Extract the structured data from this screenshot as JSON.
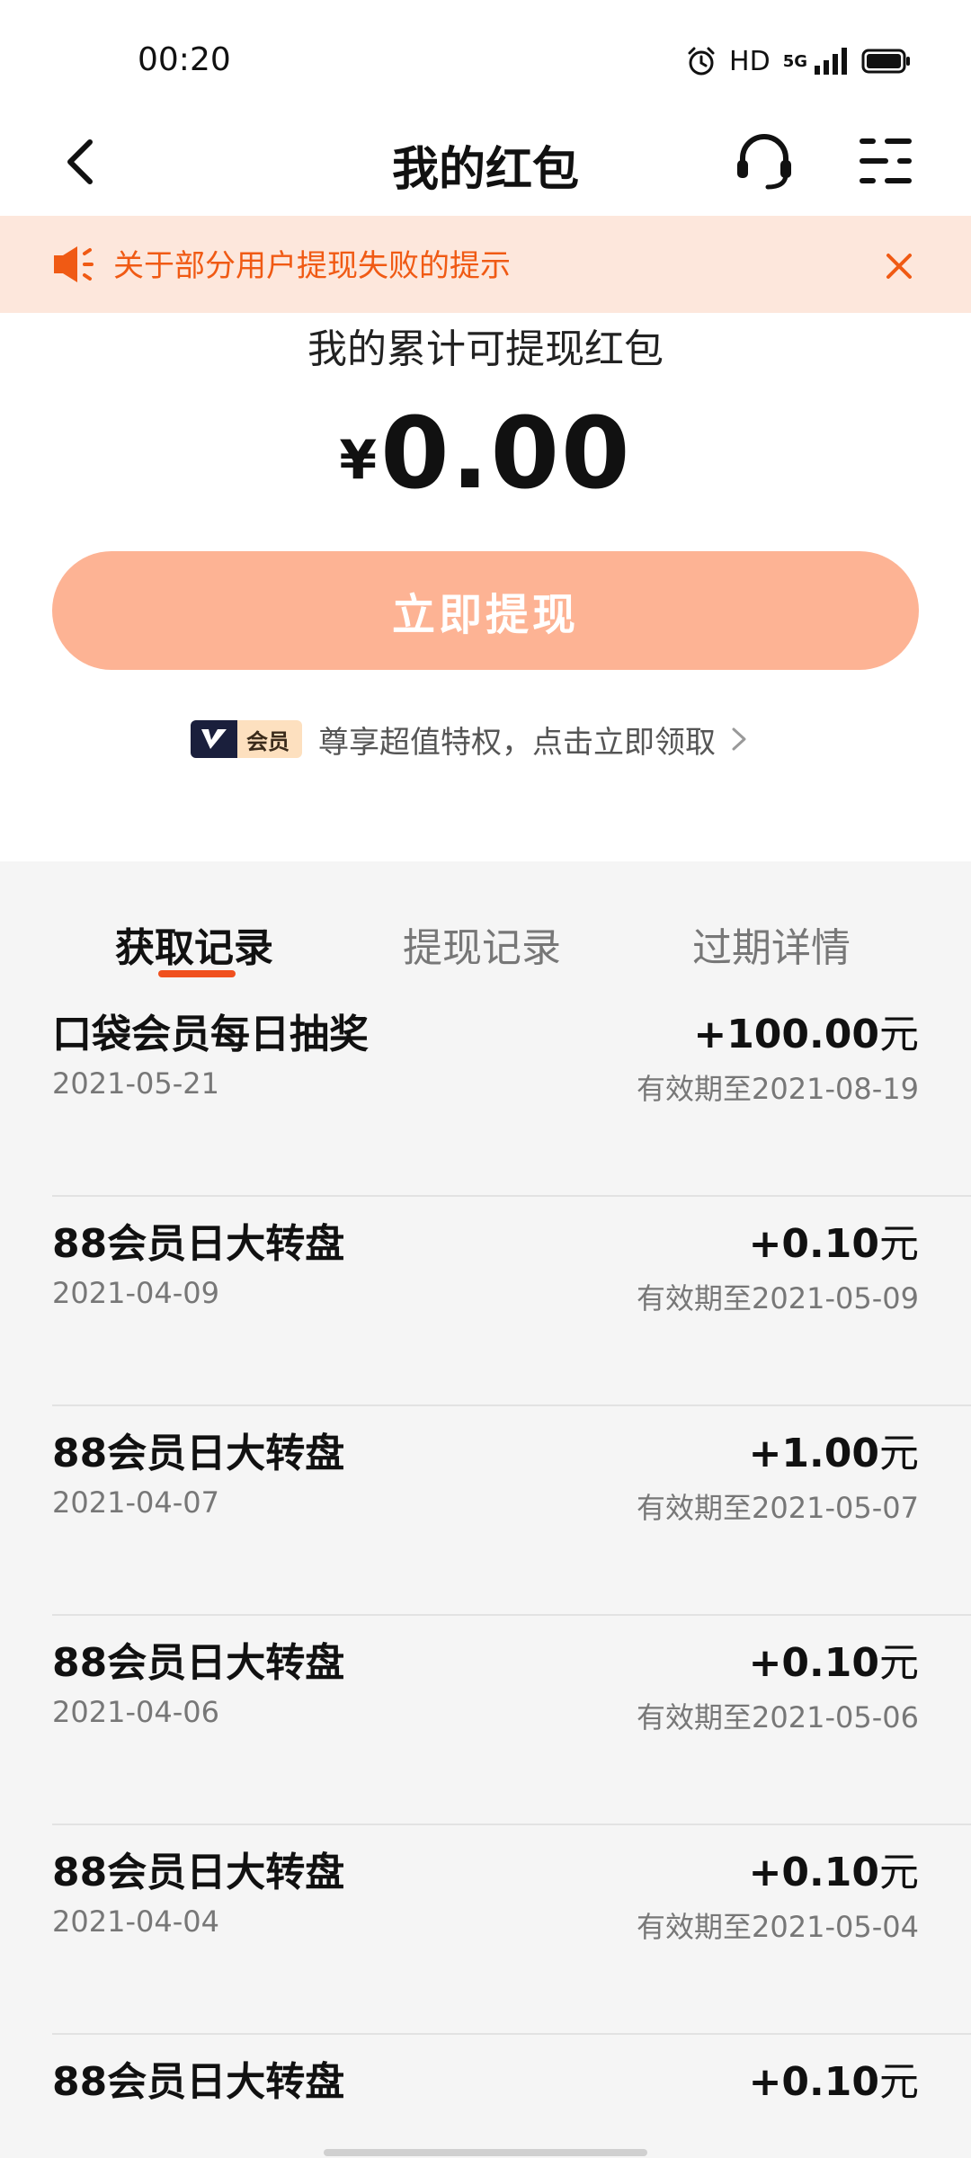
{
  "status_bar": {
    "time": "00:20",
    "hd_label": "HD",
    "network_label": "5G",
    "icons": [
      "alarm-icon",
      "signal-icon",
      "battery-icon"
    ]
  },
  "nav": {
    "title": "我的红包",
    "icons": [
      "back-arrow-icon",
      "headset-icon",
      "filter-icon"
    ]
  },
  "notice": {
    "text": "关于部分用户提现失败的提示",
    "color": "#f05a14",
    "background": "#fde7dc"
  },
  "balance": {
    "label": "我的累计可提现红包",
    "currency": "¥",
    "amount": "0.00"
  },
  "withdraw_button": {
    "label": "立即提现",
    "color": "#fdb394"
  },
  "member_promo": {
    "badge_text": "会员",
    "text": "尊享超值特权，点击立即领取"
  },
  "tabs": [
    {
      "label": "获取记录",
      "active": true
    },
    {
      "label": "提现记录",
      "active": false
    },
    {
      "label": "过期详情",
      "active": false
    }
  ],
  "accent_color": "#f0501e",
  "records": [
    {
      "title": "口袋会员每日抽奖",
      "date": "2021-05-21",
      "amount": "+100.00",
      "unit": "元",
      "expiry": "有效期至2021-08-19"
    },
    {
      "title": "88会员日大转盘",
      "date": "2021-04-09",
      "amount": "+0.10",
      "unit": "元",
      "expiry": "有效期至2021-05-09"
    },
    {
      "title": "88会员日大转盘",
      "date": "2021-04-07",
      "amount": "+1.00",
      "unit": "元",
      "expiry": "有效期至2021-05-07"
    },
    {
      "title": "88会员日大转盘",
      "date": "2021-04-06",
      "amount": "+0.10",
      "unit": "元",
      "expiry": "有效期至2021-05-06"
    },
    {
      "title": "88会员日大转盘",
      "date": "2021-04-04",
      "amount": "+0.10",
      "unit": "元",
      "expiry": "有效期至2021-05-04"
    },
    {
      "title": "88会员日大转盘",
      "date": "",
      "amount": "+0.10",
      "unit": "元",
      "expiry": ""
    }
  ]
}
